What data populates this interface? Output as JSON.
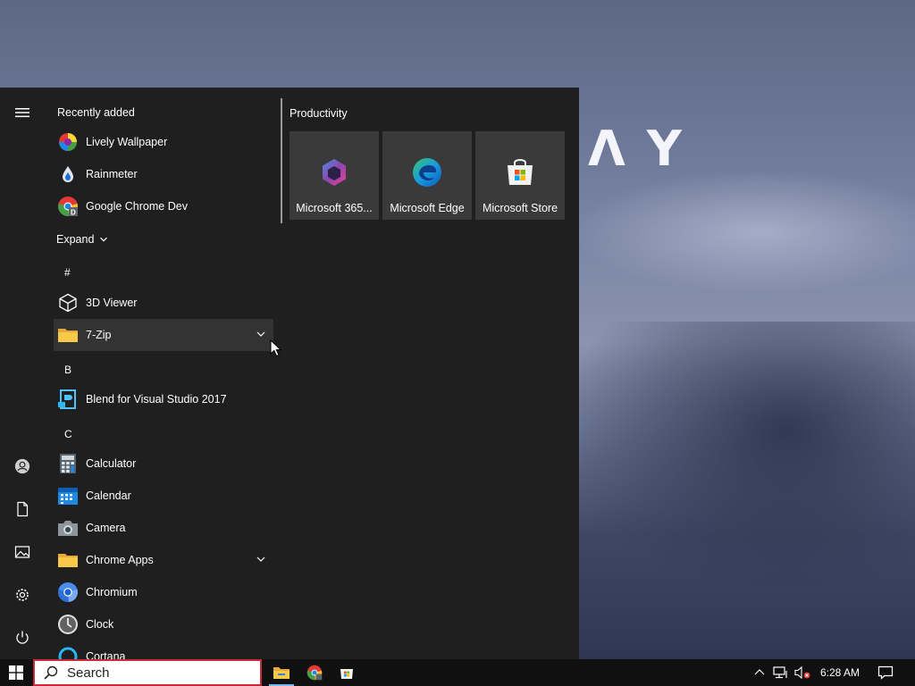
{
  "desktop": {
    "wallpaper_logo_text": "ΛY"
  },
  "start_menu": {
    "recently_added_label": "Recently added",
    "recent_apps": [
      {
        "label": "Lively Wallpaper",
        "icon": "lively-wallpaper-icon"
      },
      {
        "label": "Rainmeter",
        "icon": "rainmeter-icon"
      },
      {
        "label": "Google Chrome Dev",
        "icon": "chrome-dev-icon"
      }
    ],
    "expand_label": "Expand",
    "sections": [
      {
        "letter": "#",
        "apps": [
          {
            "label": "3D Viewer",
            "icon": "3d-viewer-icon"
          },
          {
            "label": "7-Zip",
            "icon": "folder-icon",
            "expandable": true,
            "hovered": true
          }
        ]
      },
      {
        "letter": "B",
        "apps": [
          {
            "label": "Blend for Visual Studio 2017",
            "icon": "blend-icon"
          }
        ]
      },
      {
        "letter": "C",
        "apps": [
          {
            "label": "Calculator",
            "icon": "calculator-icon"
          },
          {
            "label": "Calendar",
            "icon": "calendar-icon"
          },
          {
            "label": "Camera",
            "icon": "camera-icon"
          },
          {
            "label": "Chrome Apps",
            "icon": "folder-icon",
            "expandable": true
          },
          {
            "label": "Chromium",
            "icon": "chromium-icon"
          },
          {
            "label": "Clock",
            "icon": "clock-icon"
          },
          {
            "label": "Cortana",
            "icon": "cortana-icon"
          }
        ]
      }
    ],
    "rail": [
      "menu-icon",
      "user-icon",
      "documents-icon",
      "pictures-icon",
      "settings-icon",
      "power-icon"
    ],
    "tile_group": {
      "title": "Productivity",
      "tiles": [
        {
          "label": "Microsoft 365...",
          "icon": "microsoft-365-icon"
        },
        {
          "label": "Microsoft Edge",
          "icon": "edge-icon"
        },
        {
          "label": "Microsoft Store",
          "icon": "store-icon"
        }
      ]
    }
  },
  "taskbar": {
    "search_placeholder": "Search",
    "pinned_apps": [
      {
        "name": "File Explorer",
        "icon": "file-explorer-icon",
        "active": true
      },
      {
        "name": "Chrome",
        "icon": "chrome-icon"
      },
      {
        "name": "Microsoft Store",
        "icon": "store-icon"
      }
    ],
    "clock": "6:28 AM"
  },
  "colors": {
    "start_bg": "#1f1f1f",
    "tile_bg": "#3a3a3a",
    "taskbar_bg": "#101010",
    "search_border": "#c9293a"
  }
}
